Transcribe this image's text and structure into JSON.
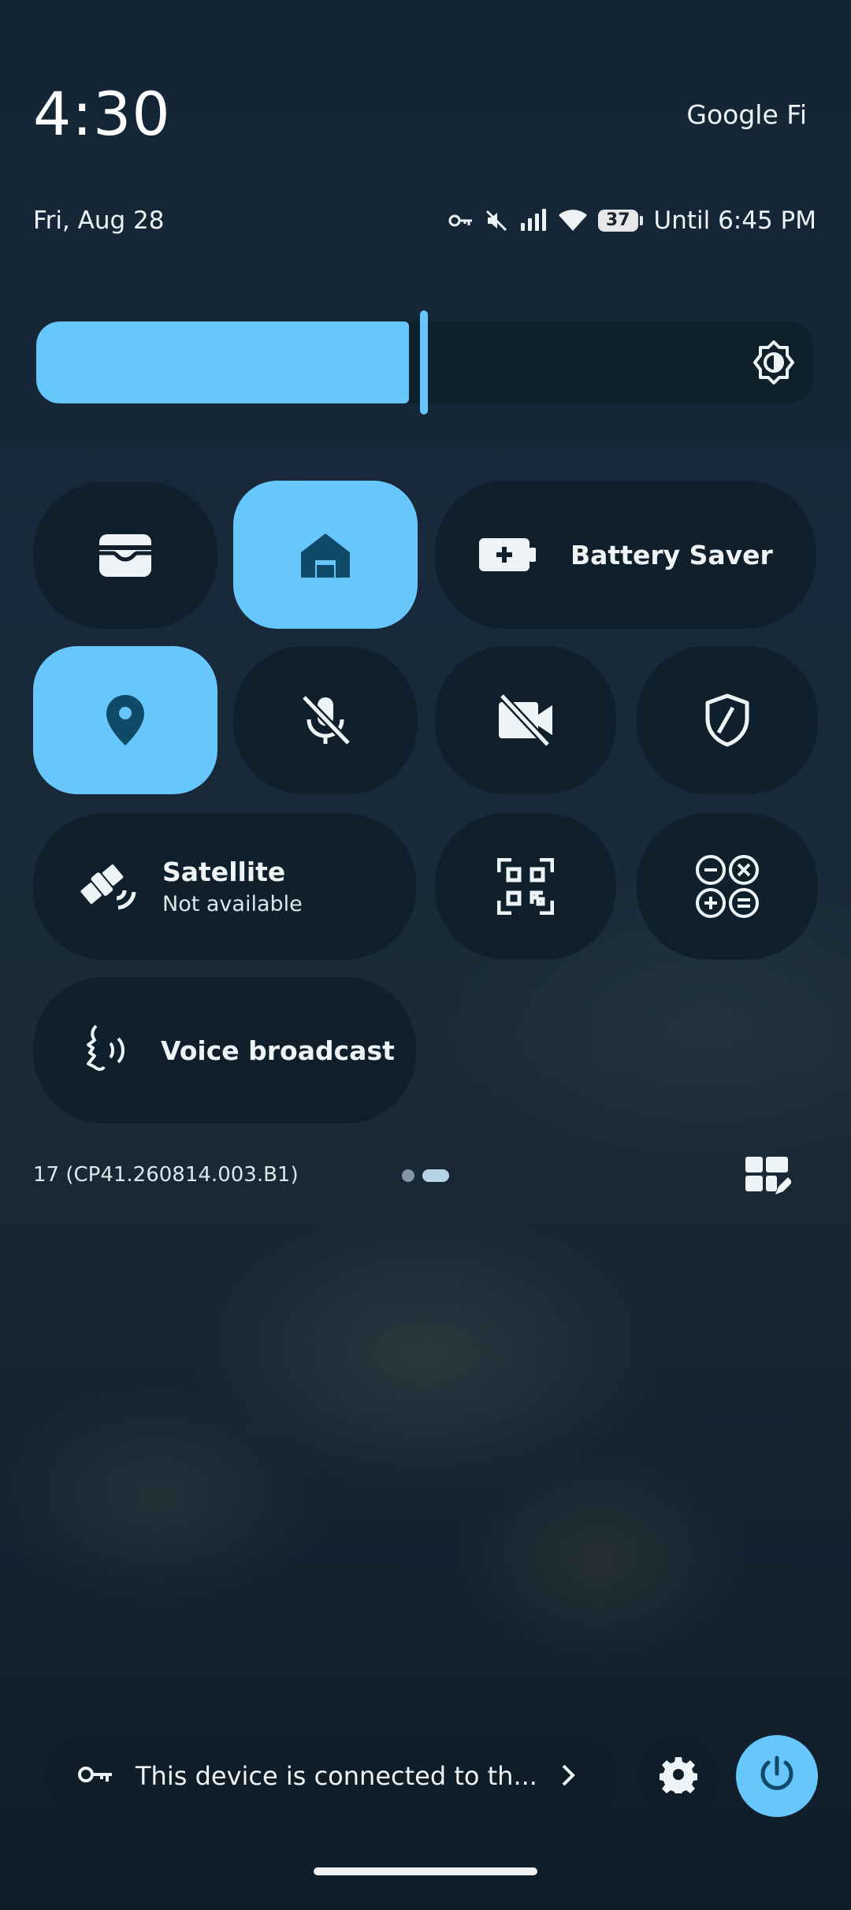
{
  "header": {
    "clock": "4:30",
    "carrier": "Google Fi",
    "date": "Fri, Aug 28",
    "battery_percent": "37",
    "battery_estimate": "Until 6:45 PM",
    "status_icons": [
      "vpn-key-icon",
      "mute-icon",
      "signal-icon",
      "wifi-icon",
      "battery-icon"
    ]
  },
  "brightness": {
    "level_fraction": 0.5,
    "icon": "auto-brightness-icon"
  },
  "tiles": {
    "wallet": {
      "icon": "wallet-icon",
      "active": false
    },
    "home": {
      "icon": "home-icon",
      "active": true
    },
    "battery_saver": {
      "icon": "battery-plus-icon",
      "label": "Battery Saver",
      "active": false
    },
    "location": {
      "icon": "location-pin-icon",
      "active": true
    },
    "mic": {
      "icon": "mic-off-icon",
      "active": false
    },
    "camera": {
      "icon": "camera-off-icon",
      "active": false
    },
    "security": {
      "icon": "shield-icon",
      "active": false
    },
    "satellite": {
      "icon": "satellite-icon",
      "label": "Satellite",
      "sublabel": "Not available",
      "active": false
    },
    "qr": {
      "icon": "qr-scanner-icon",
      "active": false
    },
    "calculator": {
      "icon": "calculator-icon",
      "active": false
    },
    "voice": {
      "icon": "voice-broadcast-icon",
      "label": "Voice broadcast",
      "active": false
    }
  },
  "footer": {
    "build": "17 (CP41.260814.003.B1)",
    "page_count": 2,
    "current_page": 2,
    "notice": "This device is connected to th...",
    "notice_icon": "vpn-key-icon"
  },
  "colors": {
    "accent": "#67c6fb",
    "tile_bg": "#0f202c",
    "icon_on_accent": "#0f4a68",
    "text": "#eef3f6"
  }
}
